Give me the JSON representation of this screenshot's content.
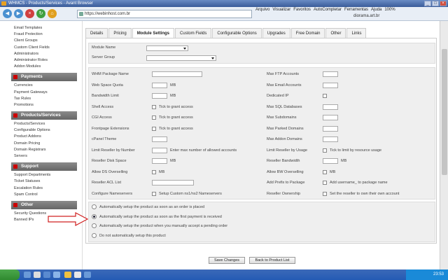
{
  "window": {
    "title": "WHMCS - Products/Services - Avant Browser"
  },
  "browser": {
    "url": "https://webinhost.com.br",
    "menu": [
      "Arquivo",
      "Visualizar",
      "Favoritos",
      "AutoCompletar",
      "Ferramentas",
      "Ajuda",
      "100%"
    ],
    "second_tab": "diorama.art.br"
  },
  "sidebar": {
    "top_items": [
      "Email Templates",
      "Fraud Protection",
      "Client Groups",
      "Custom Client Fields",
      "Administrators",
      "Administrator Roles",
      "Addon Modules"
    ],
    "sections": [
      {
        "title": "Payments",
        "items": [
          "Currencies",
          "Payment Gateways",
          "Tax Rules",
          "Promotions"
        ]
      },
      {
        "title": "Products/Services",
        "items": [
          "Products/Services",
          "Configurable Options",
          "Product Addons",
          "Domain Pricing",
          "Domain Registrars",
          "Servers"
        ]
      },
      {
        "title": "Support",
        "items": [
          "Support Departments",
          "Ticket Statuses",
          "Escalation Rules",
          "Spam Control"
        ]
      },
      {
        "title": "Other",
        "items": [
          "Security Questions",
          "Banned IPs"
        ]
      }
    ]
  },
  "tabs": [
    "Details",
    "Pricing",
    "Module Settings",
    "Custom Fields",
    "Configurable Options",
    "Upgrades",
    "Free Domain",
    "Other",
    "Links"
  ],
  "module": {
    "module_name_label": "Module Name",
    "module_name_value": "",
    "server_group_label": "Server Group"
  },
  "settings": {
    "left": [
      {
        "label": "WHM Package Name",
        "type": "text"
      },
      {
        "label": "Web Space Quota",
        "type": "text",
        "suffix": "MB"
      },
      {
        "label": "Bandwidth Limit",
        "type": "text",
        "suffix": "MB"
      },
      {
        "label": "Shell Access",
        "type": "check",
        "text": "Tick to grant access"
      },
      {
        "label": "CGI Access",
        "type": "check",
        "text": "Tick to grant access"
      },
      {
        "label": "Frontpage Extensions",
        "type": "check",
        "text": "Tick to grant access"
      },
      {
        "label": "cPanel Theme",
        "type": "text"
      },
      {
        "label": "Limit Reseller by Number",
        "type": "text",
        "text": "Enter max number of allowed accounts"
      },
      {
        "label": "Reseller Disk Space",
        "type": "text",
        "suffix": "MB"
      },
      {
        "label": "Allow DS Overselling",
        "type": "check",
        "text": "MB"
      },
      {
        "label": "Reseller ACL List",
        "type": "text"
      },
      {
        "label": "Configure Nameservers",
        "type": "check",
        "text": "Setup Custom ns1/ns2 Nameservers"
      }
    ],
    "right": [
      {
        "label": "Max FTP Accounts",
        "type": "text"
      },
      {
        "label": "Max Email Accounts",
        "type": "text"
      },
      {
        "label": "Dedicated IP",
        "type": "check",
        "text": ""
      },
      {
        "label": "Max SQL Databases",
        "type": "text"
      },
      {
        "label": "Max Subdomains",
        "type": "text"
      },
      {
        "label": "Max Parked Domains",
        "type": "text"
      },
      {
        "label": "Max Addon Domains",
        "type": "text"
      },
      {
        "label": "Limit Reseller by Usage",
        "type": "check",
        "text": "Tick to limit by resource usage"
      },
      {
        "label": "Reseller Bandwidth",
        "type": "text",
        "suffix": "MB"
      },
      {
        "label": "Allow BW Overselling",
        "type": "check",
        "text": "MB"
      },
      {
        "label": "Add Prefix to Package",
        "type": "check",
        "text": "Add username_ to package name"
      },
      {
        "label": "Reseller Ownership",
        "type": "check",
        "text": "Set the reseller to own their own account"
      }
    ]
  },
  "setup_options": {
    "selected": 1,
    "items": [
      "Automatically setup the product as soon as an order is placed",
      "Automatically setup the product as soon as the first payment is received",
      "Automatically setup the product when you manually accept a pending order",
      "Do not automatically setup this product"
    ]
  },
  "buttons": {
    "save": "Save Changes",
    "back": "Back to Product List"
  },
  "taskbar": {
    "clock": "23:53"
  },
  "colors": {
    "arrow": "#d02020",
    "sidebar_header": "#777777",
    "taskbar": "#245bb4"
  }
}
